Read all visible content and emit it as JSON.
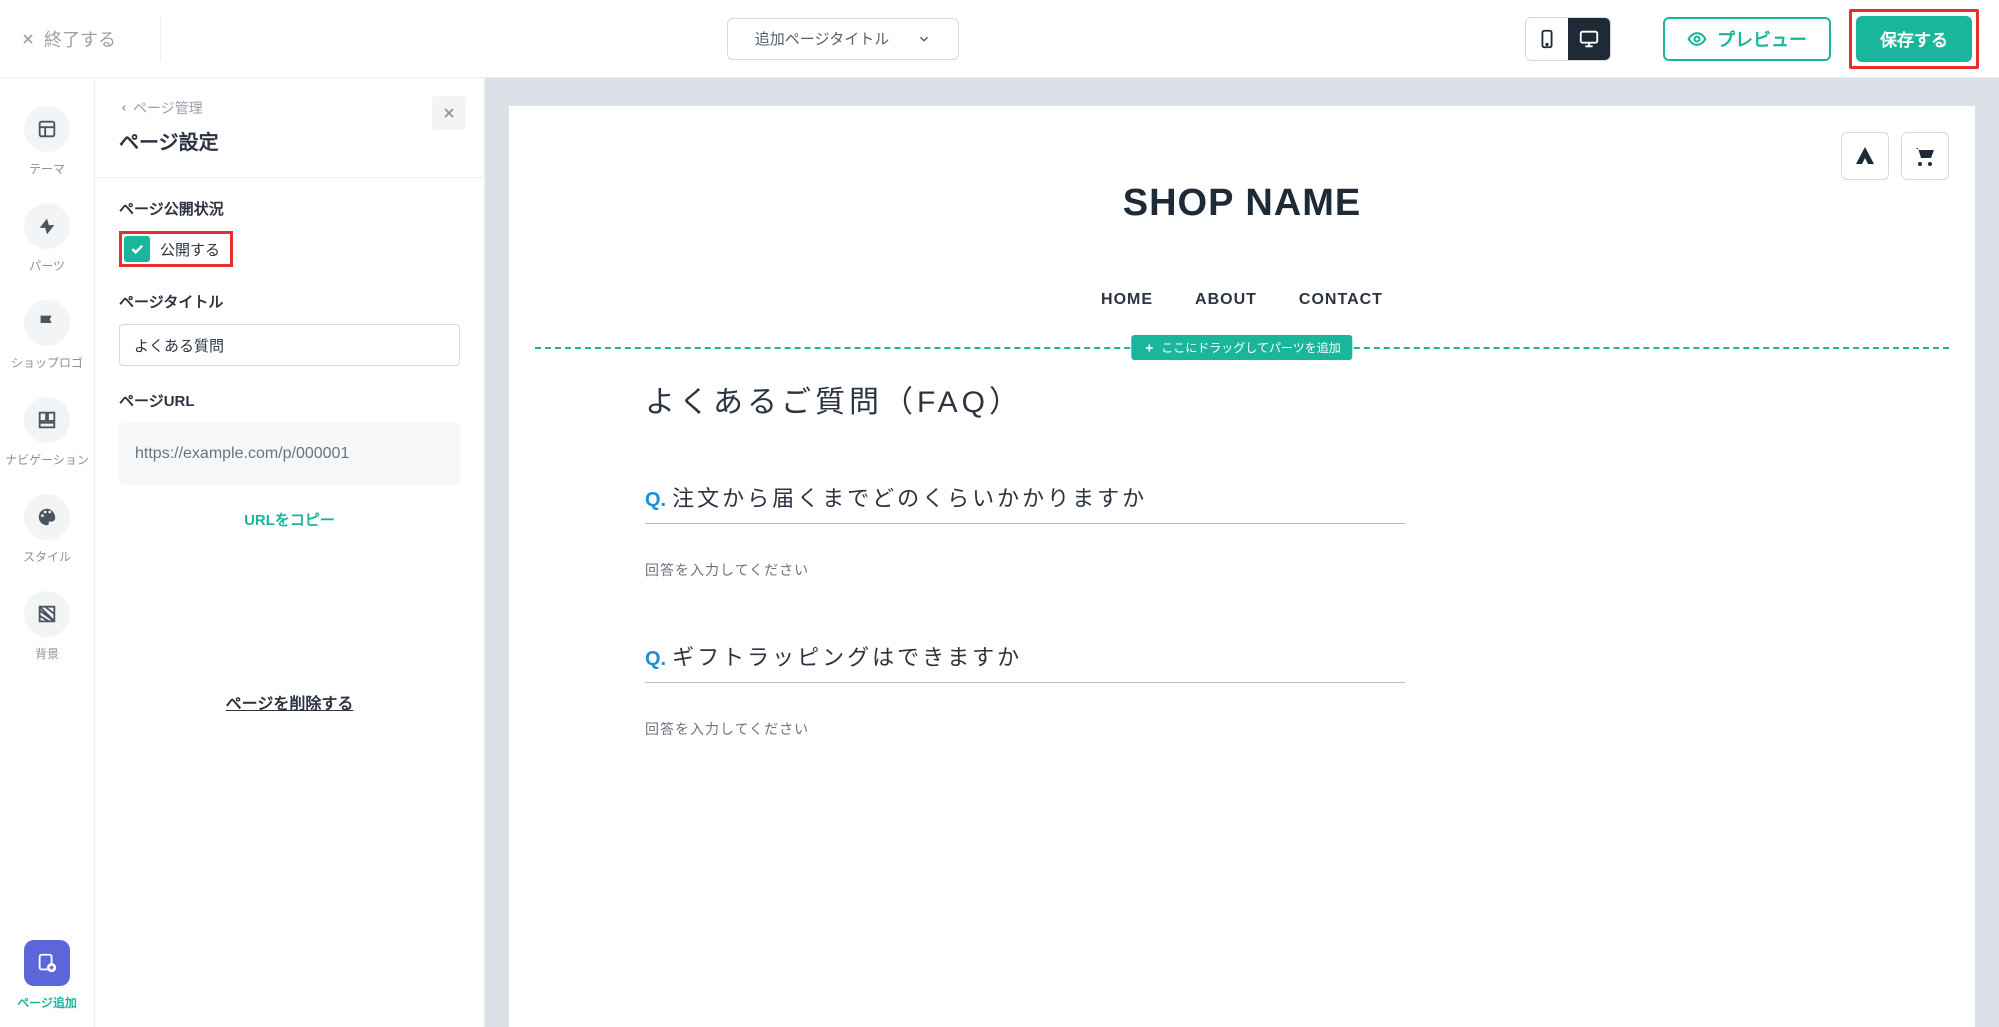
{
  "topbar": {
    "exit": "終了する",
    "page_selector": "追加ページタイトル",
    "preview": "プレビュー",
    "save": "保存する"
  },
  "sidebar": {
    "theme": "テーマ",
    "parts": "パーツ",
    "shop_logo": "ショップロゴ",
    "navigation": "ナビゲーション",
    "style": "スタイル",
    "background": "背景",
    "add_page": "ページ追加"
  },
  "panel": {
    "breadcrumb": "ページ管理",
    "title": "ページ設定",
    "publish_status_label": "ページ公開状況",
    "publish_checkbox": "公開する",
    "page_title_label": "ページタイトル",
    "page_title_value": "よくある質問",
    "page_url_label": "ページURL",
    "page_url_value": "https://example.com/p/000001",
    "copy_url": "URLをコピー",
    "delete_page": "ページを削除する"
  },
  "canvas": {
    "shop_name": "SHOP NAME",
    "nav": {
      "home": "HOME",
      "about": "ABOUT",
      "contact": "CONTACT"
    },
    "dropzone": "ここにドラッグしてパーツを追加",
    "faq_heading": "よくあるご質問（FAQ）",
    "q_prefix": "Q.",
    "q1": "注文から届くまでどのくらいかかりますか",
    "answer_placeholder": "回答を入力してください",
    "q2": "ギフトラッピングはできますか"
  }
}
